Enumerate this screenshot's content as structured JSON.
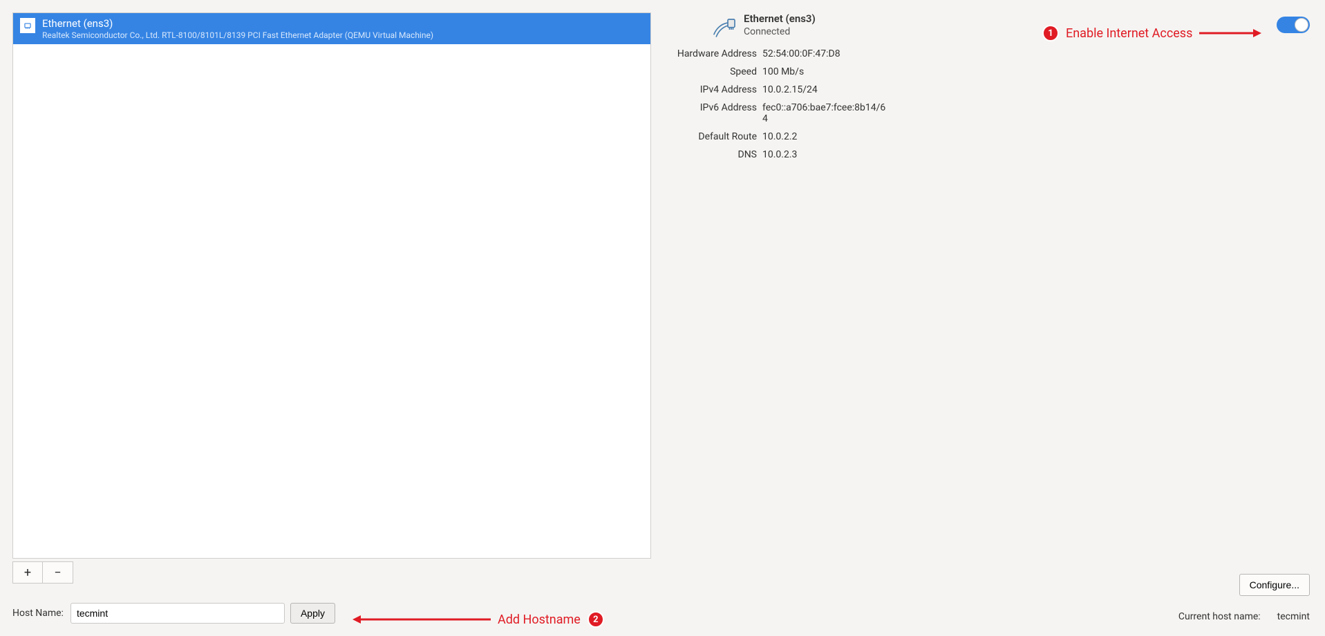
{
  "left": {
    "device": {
      "title": "Ethernet (ens3)",
      "subtitle": "Realtek Semiconductor Co., Ltd. RTL-8100/8101L/8139 PCI Fast Ethernet Adapter (QEMU Virtual Machine)"
    },
    "add_label": "+",
    "remove_label": "−"
  },
  "hostname": {
    "label": "Host Name:",
    "value": "tecmint",
    "apply_label": "Apply"
  },
  "detail": {
    "title": "Ethernet (ens3)",
    "status": "Connected",
    "rows": {
      "hw_label": "Hardware Address",
      "hw_value": "52:54:00:0F:47:D8",
      "speed_label": "Speed",
      "speed_value": "100 Mb/s",
      "ipv4_label": "IPv4 Address",
      "ipv4_value": "10.0.2.15/24",
      "ipv6_label": "IPv6 Address",
      "ipv6_value": "fec0::a706:bae7:fcee:8b14/64",
      "route_label": "Default Route",
      "route_value": "10.0.2.2",
      "dns_label": "DNS",
      "dns_value": "10.0.2.3"
    }
  },
  "configure_label": "Configure...",
  "current_host": {
    "label": "Current host name:",
    "value": "tecmint"
  },
  "annotations": {
    "a1_num": "1",
    "a1_text": "Enable Internet Access",
    "a2_num": "2",
    "a2_text": "Add Hostname"
  }
}
